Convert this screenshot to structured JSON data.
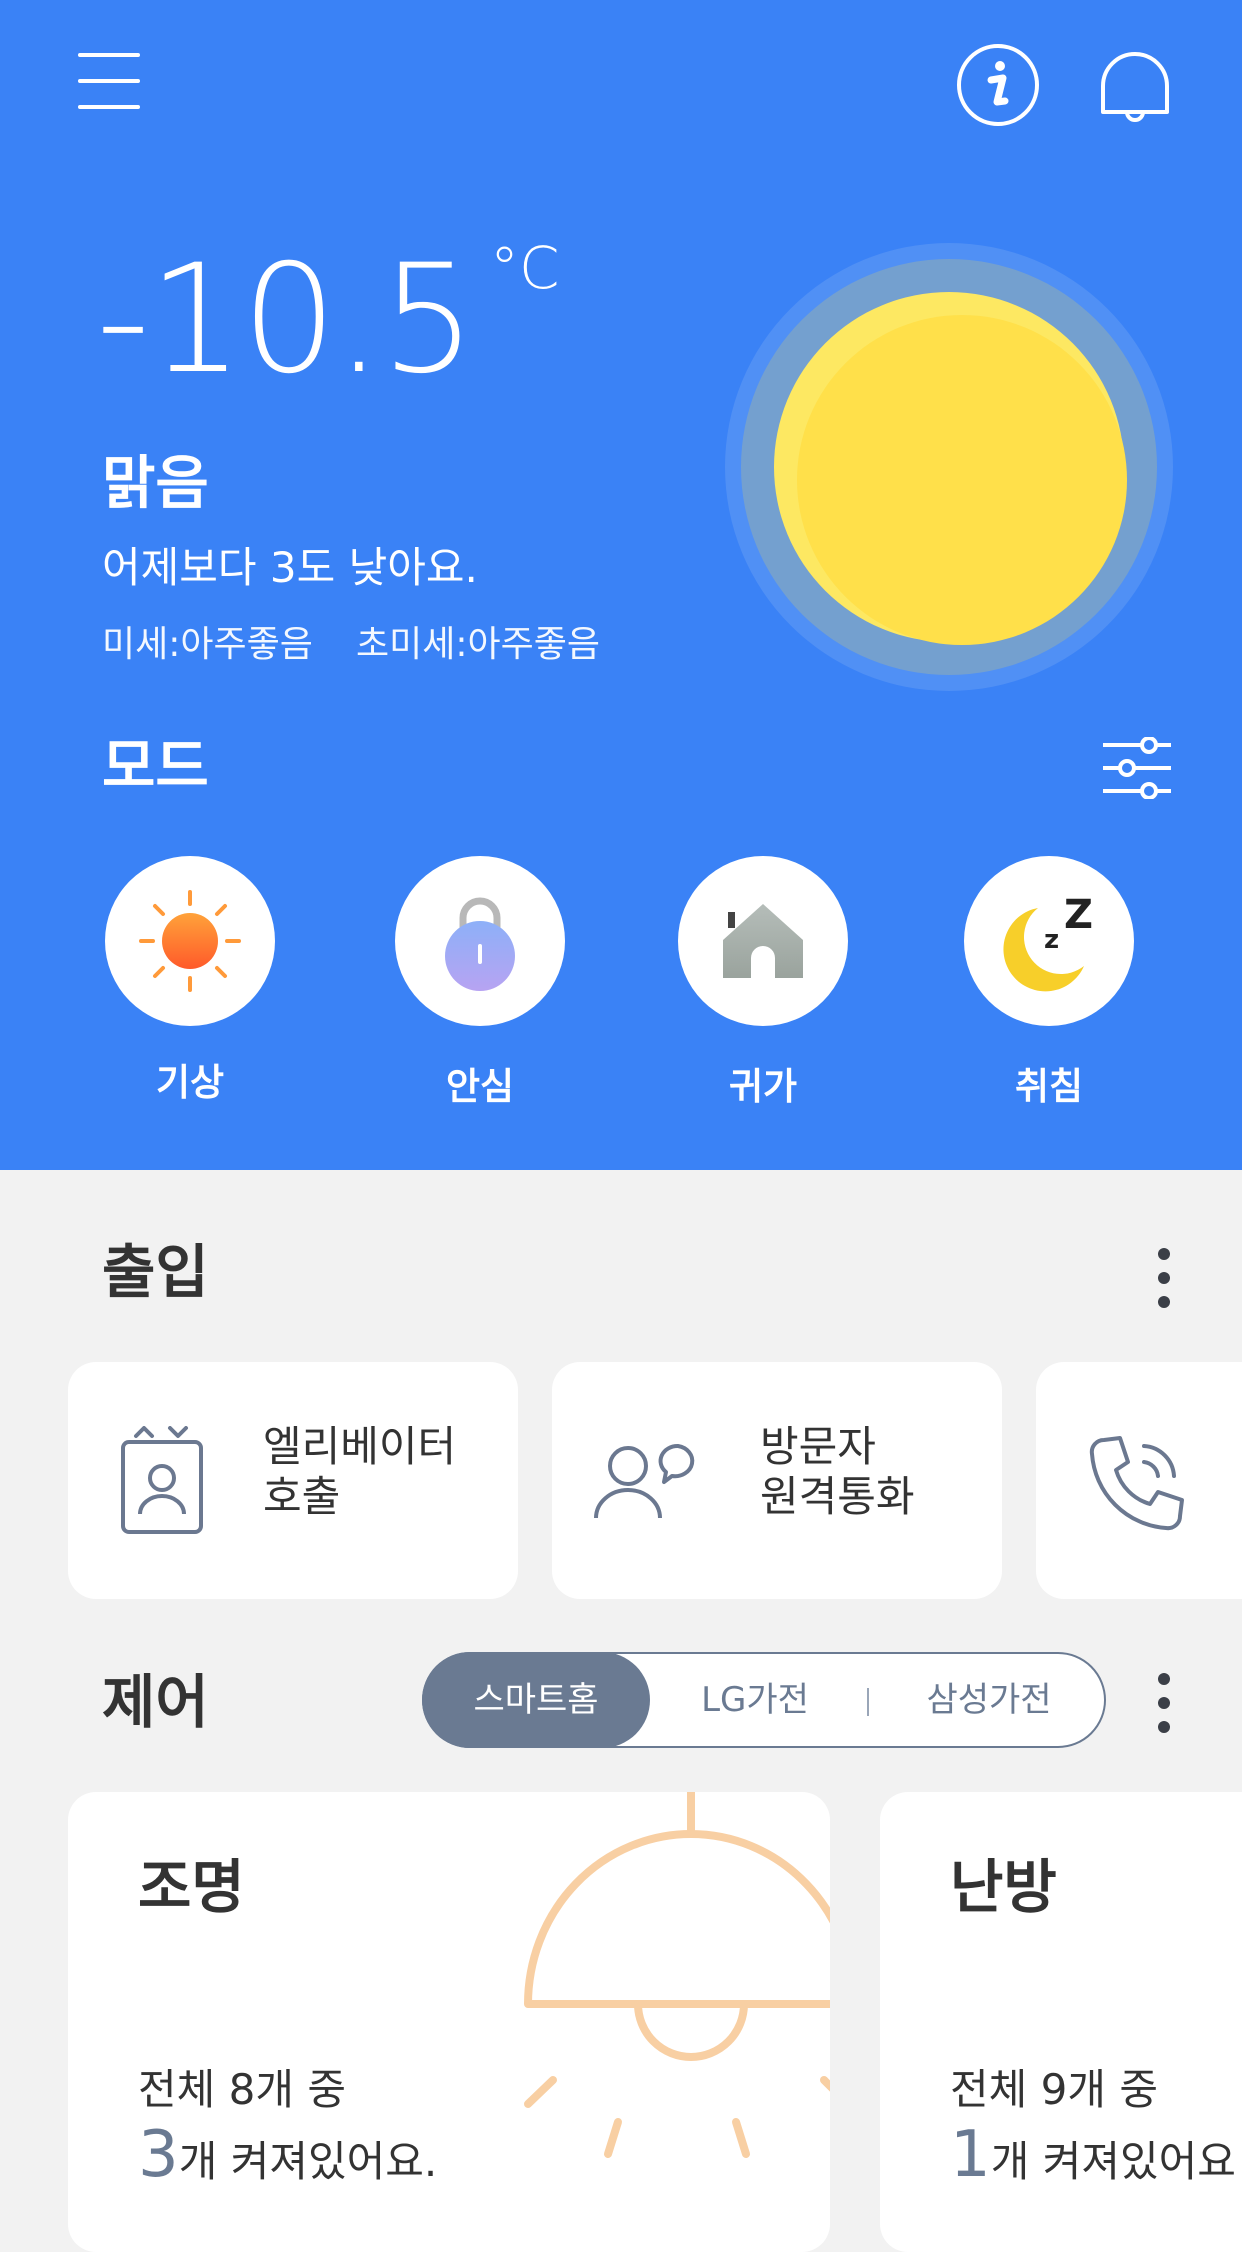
{
  "header": {
    "menu_icon": "hamburger-menu-icon",
    "info_icon": "info-icon",
    "bell_icon": "bell-icon"
  },
  "weather": {
    "temperature": "-10.5",
    "unit": "°C",
    "condition": "맑음",
    "comparison": "어제보다 3도 낮아요.",
    "dust": "미세:아주좋음",
    "fine_dust": "초미세:아주좋음",
    "icon": "sun-weather-icon"
  },
  "mode": {
    "title": "모드",
    "settings_icon": "sliders-icon",
    "items": [
      {
        "label": "기상",
        "icon": "sunrise-icon"
      },
      {
        "label": "안심",
        "icon": "lock-icon"
      },
      {
        "label": "귀가",
        "icon": "home-icon"
      },
      {
        "label": "취침",
        "icon": "moon-sleep-icon"
      }
    ]
  },
  "access": {
    "title": "출입",
    "more_icon": "kebab-menu-icon",
    "cards": [
      {
        "line1": "엘리베이터",
        "line2": "호출",
        "icon": "elevator-call-icon"
      },
      {
        "line1": "방문자",
        "line2": "원격통화",
        "icon": "visitor-call-icon"
      },
      {
        "line1": "",
        "line2": "",
        "icon": "phone-call-icon"
      }
    ]
  },
  "control": {
    "title": "제어",
    "more_icon": "kebab-menu-icon",
    "tabs": [
      "스마트홈",
      "LG가전",
      "삼성가전"
    ],
    "active_tab": "스마트홈",
    "cards": [
      {
        "title": "조명",
        "total": "전체 8개 중",
        "count": "3",
        "status": "개 켜져있어요.",
        "icon": "pendant-lamp-icon"
      },
      {
        "title": "난방",
        "total": "전체 9개 중",
        "count": "1",
        "status": "개 켜져있어요",
        "icon": "heater-icon"
      }
    ]
  },
  "colors": {
    "hero_bg": "#3a82f6",
    "background": "#f2f2f2",
    "active_tab_bg": "#6a7a92",
    "sun_yellow": "#ffe04a",
    "lamp_stroke": "#f8cfa3"
  }
}
